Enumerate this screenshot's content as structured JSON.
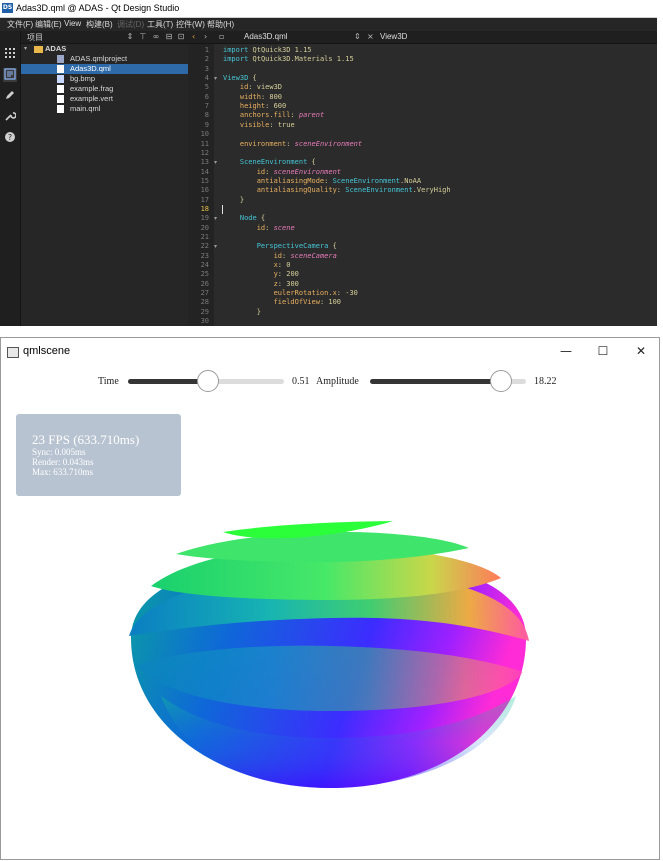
{
  "qds_window": {
    "title": "Adas3D.qml @ ADAS - Qt Design Studio",
    "menu": [
      "文件(F)",
      "编辑(E)",
      "View",
      "构建(B)",
      "调试(D)",
      "工具(T)",
      "控件(W)",
      "帮助(H)"
    ],
    "project_panel": {
      "label": "项目",
      "tree": [
        {
          "name": "ADAS",
          "kind": "folder",
          "level": 0,
          "expanded": true
        },
        {
          "name": "ADAS.qmlproject",
          "kind": "project",
          "level": 1
        },
        {
          "name": "Adas3D.qml",
          "kind": "qml",
          "level": 1,
          "selected": true
        },
        {
          "name": "bg.bmp",
          "kind": "image",
          "level": 1
        },
        {
          "name": "example.frag",
          "kind": "file",
          "level": 1
        },
        {
          "name": "example.vert",
          "kind": "file",
          "level": 1
        },
        {
          "name": "main.qml",
          "kind": "file",
          "level": 1
        }
      ]
    },
    "editor": {
      "file_name": "Adas3D.qml",
      "symbol": "View3D",
      "current_line": 18,
      "lines": [
        "import QtQuick3D 1.15",
        "import QtQuick3D.Materials 1.15",
        "",
        "View3D {",
        "    id: view3D",
        "    width: 800",
        "    height: 600",
        "    anchors.fill: parent",
        "    visible: true",
        "",
        "    environment: sceneEnvironment",
        "",
        "    SceneEnvironment {",
        "        id: sceneEnvironment",
        "        antialiasingMode: SceneEnvironment.NoAA",
        "        antialiasingQuality: SceneEnvironment.VeryHigh",
        "    }",
        "",
        "    Node {",
        "        id: scene",
        "",
        "        PerspectiveCamera {",
        "            id: sceneCamera",
        "            x: 0",
        "            y: 200",
        "            z: 300",
        "            eulerRotation.x: -30",
        "            fieldOfView: 100",
        "        }",
        ""
      ]
    }
  },
  "qmlscene_window": {
    "title": "qmlscene",
    "controls": {
      "time_label": "Time",
      "time_value_text": "0.51",
      "time_fraction": 0.51,
      "amplitude_label": "Amplitude",
      "amplitude_value_text": "18.22",
      "amplitude_fraction": 0.84
    },
    "stats": {
      "fps": "23 FPS (633.710ms)",
      "sync": "Sync: 0.005ms",
      "render": "Render: 0.043ms",
      "max": "Max: 633.710ms"
    }
  },
  "colors": {
    "ide_bg": "#2b2b2b",
    "selection": "#2e6aa8",
    "fps_panel": "#b8c3d1",
    "slider_fill": "#353535"
  }
}
